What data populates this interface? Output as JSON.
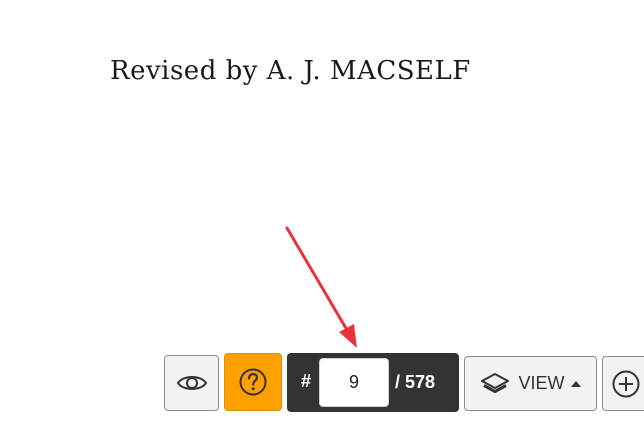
{
  "document": {
    "scan_line": "Revised by A. J. MACSELF"
  },
  "toolbar": {
    "view_toggle_icon": "eye-icon",
    "help_icon": "question-circle-icon",
    "help_color": "#ff9f00",
    "page_hash": "#",
    "current_page": "9",
    "page_total": "/ 578",
    "view_label": "VIEW",
    "view_icon": "layers-icon",
    "zoom_icon": "plus-circle-icon"
  },
  "annotation": {
    "arrow_color": "#e8323c"
  }
}
